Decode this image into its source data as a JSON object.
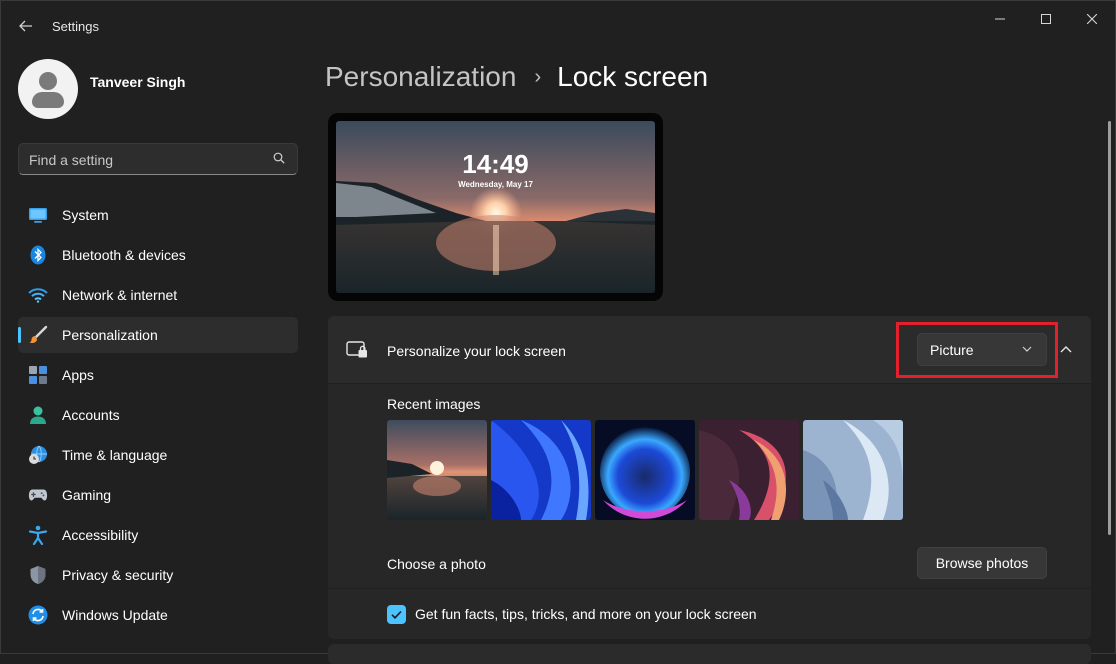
{
  "window": {
    "title": "Settings",
    "controls": {
      "minimize": "—",
      "maximize": "☐",
      "close": "✕"
    }
  },
  "user": {
    "name": "Tanveer Singh"
  },
  "search": {
    "placeholder": "Find a setting"
  },
  "sidebar": {
    "items": [
      {
        "label": "System",
        "icon": "system-icon",
        "active": false
      },
      {
        "label": "Bluetooth & devices",
        "icon": "bluetooth-icon",
        "active": false
      },
      {
        "label": "Network & internet",
        "icon": "wifi-icon",
        "active": false
      },
      {
        "label": "Personalization",
        "icon": "brush-icon",
        "active": true
      },
      {
        "label": "Apps",
        "icon": "apps-icon",
        "active": false
      },
      {
        "label": "Accounts",
        "icon": "accounts-icon",
        "active": false
      },
      {
        "label": "Time & language",
        "icon": "globe-clock-icon",
        "active": false
      },
      {
        "label": "Gaming",
        "icon": "gamepad-icon",
        "active": false
      },
      {
        "label": "Accessibility",
        "icon": "accessibility-icon",
        "active": false
      },
      {
        "label": "Privacy & security",
        "icon": "shield-icon",
        "active": false
      },
      {
        "label": "Windows Update",
        "icon": "update-icon",
        "active": false
      }
    ]
  },
  "header": {
    "parent": "Personalization",
    "separator": "›",
    "current": "Lock screen"
  },
  "preview": {
    "time": "14:49",
    "date": "Wednesday, May 17"
  },
  "lock_screen": {
    "title": "Personalize your lock screen",
    "dropdown_value": "Picture",
    "recent_images_label": "Recent images",
    "recent_images": [
      "sunset-lake-thumbnail",
      "blue-bloom-thumbnail",
      "glow-orb-thumbnail",
      "ribbon-swirl-thumbnail",
      "pale-bloom-thumbnail"
    ],
    "choose_photo_label": "Choose a photo",
    "browse_label": "Browse photos",
    "tips_label": "Get fun facts, tips, tricks, and more on your lock screen",
    "tips_checked": true
  },
  "colors": {
    "accent": "#4cc2ff",
    "highlight": "#e3202c",
    "background": "#202020",
    "card": "#2b2b2b"
  }
}
